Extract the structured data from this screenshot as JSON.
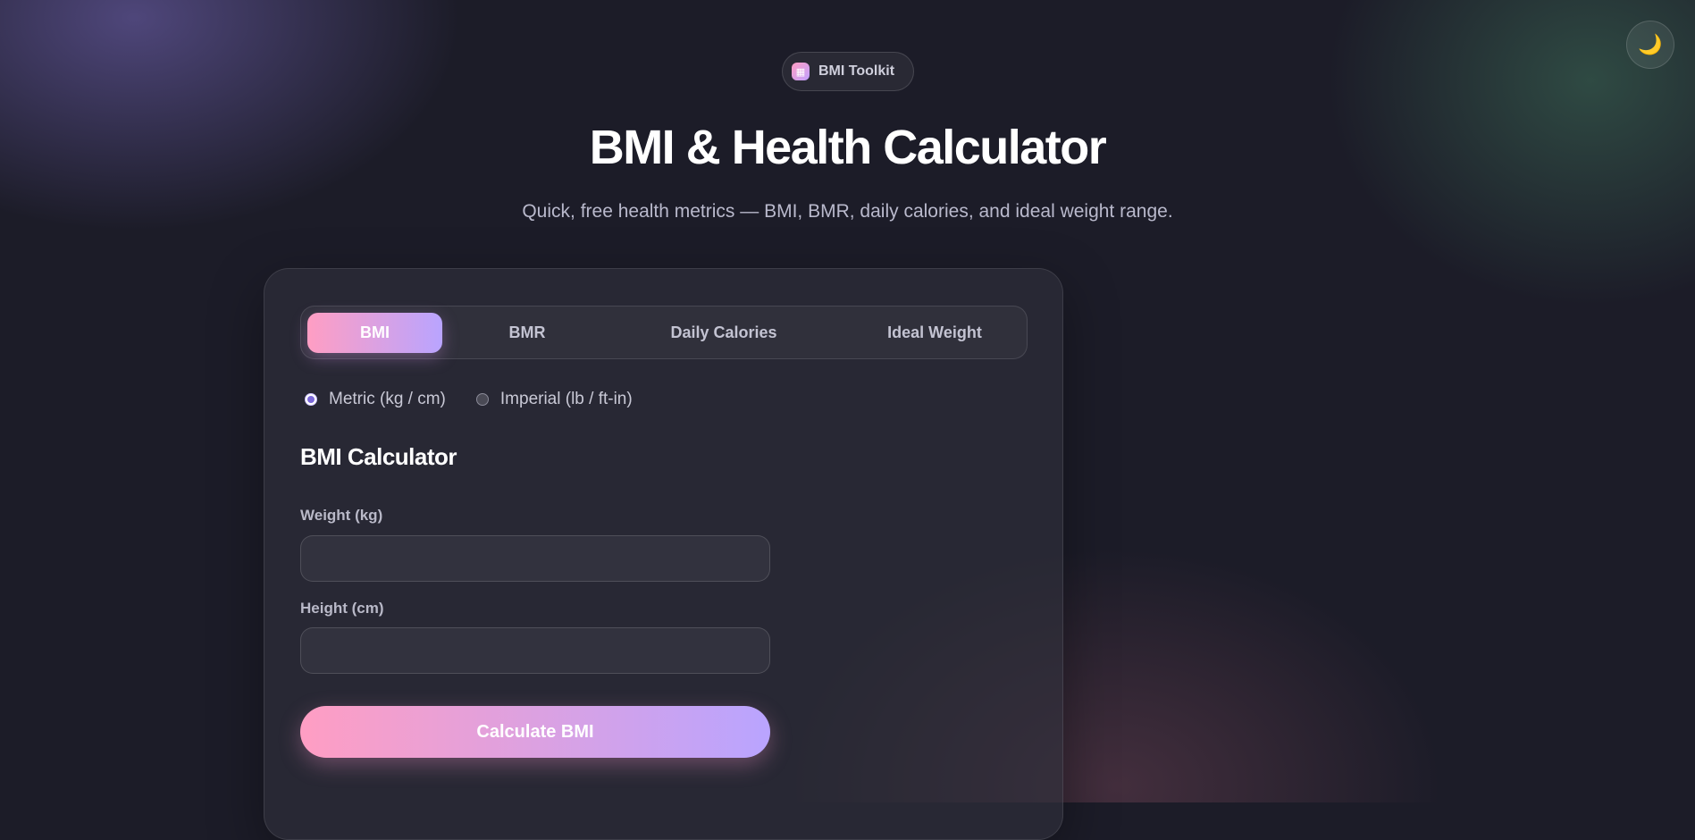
{
  "theme_toggle": {
    "icon": "moon-icon",
    "glyph": "🌙"
  },
  "badge": {
    "icon": "calculator-icon",
    "glyph": "▦",
    "label": "BMI Toolkit"
  },
  "header": {
    "title": "BMI & Health Calculator",
    "subtitle": "Quick, free health metrics — BMI, BMR, daily calories, and ideal weight range."
  },
  "tabs": [
    {
      "label": "BMI",
      "active": true
    },
    {
      "label": "BMR",
      "active": false
    },
    {
      "label": "Daily Calories",
      "active": false
    },
    {
      "label": "Ideal Weight",
      "active": false
    }
  ],
  "units": {
    "options": [
      {
        "label": "Metric (kg / cm)",
        "checked": true
      },
      {
        "label": "Imperial (lb / ft-in)",
        "checked": false
      }
    ]
  },
  "form": {
    "title": "BMI Calculator",
    "weight_label": "Weight (kg)",
    "weight_value": "",
    "height_label": "Height (cm)",
    "height_value": "",
    "submit_label": "Calculate BMI"
  },
  "colors": {
    "accent_start": "#ff9ec3",
    "accent_end": "#b9a4ff",
    "background": "#1c1c28"
  }
}
